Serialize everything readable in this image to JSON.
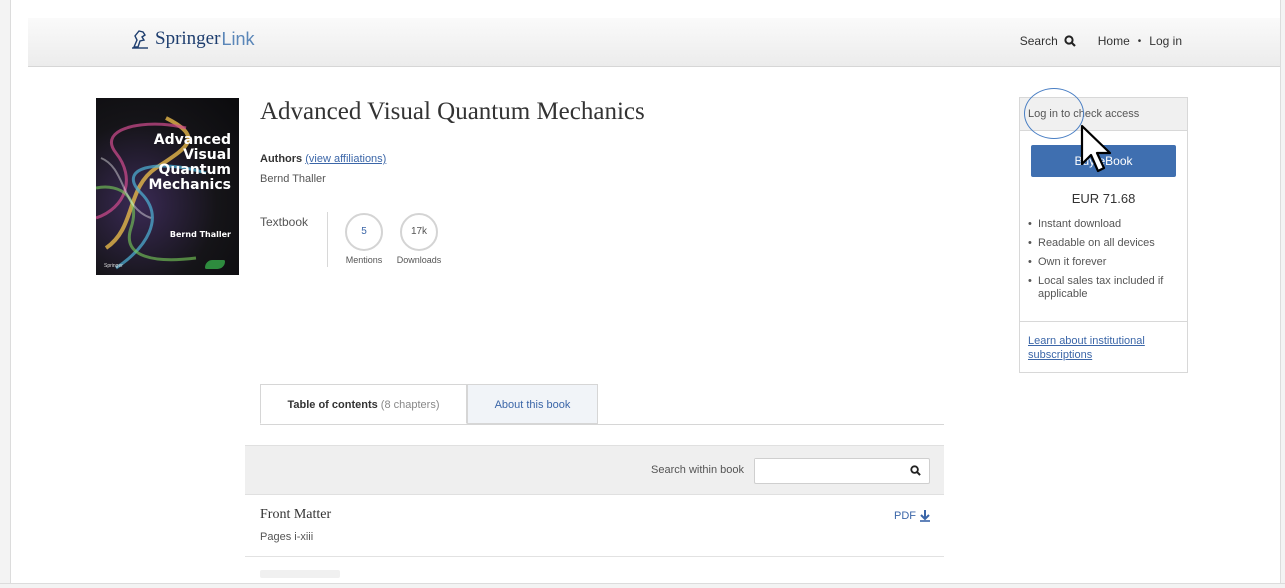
{
  "header": {
    "logo_brand": "Springer",
    "logo_sub": "Link",
    "search_label": "Search",
    "home_label": "Home",
    "login_label": "Log in"
  },
  "cover": {
    "title_line1": "Advanced",
    "title_line2": "Visual",
    "title_line3": "Quantum",
    "title_line4": "Mechanics",
    "author": "Bernd Thaller",
    "publisher": "Springer"
  },
  "book": {
    "title": "Advanced Visual Quantum Mechanics",
    "authors_label": "Authors",
    "affiliations_link": "(view affiliations)",
    "author_name": "Bernd Thaller",
    "type": "Textbook",
    "metrics": [
      {
        "value": "5",
        "label": "Mentions"
      },
      {
        "value": "17k",
        "label": "Downloads"
      }
    ]
  },
  "tabs": {
    "toc_label": "Table of contents",
    "toc_count": "(8 chapters)",
    "about_label": "About this book"
  },
  "search_within": {
    "label": "Search within book",
    "placeholder": ""
  },
  "chapters": [
    {
      "title": "Front Matter",
      "pages": "Pages i-xiii",
      "pdf": "PDF"
    }
  ],
  "buybox": {
    "header": "Log in to check access",
    "buy_button": "Buy eBook",
    "price": "EUR 71.68",
    "perks": [
      "Instant download",
      "Readable on all devices",
      "Own it forever",
      "Local sales tax included if applicable"
    ],
    "institutional_link": "Learn about institutional subscriptions"
  },
  "colors": {
    "link": "#3b66a8",
    "button": "#3f6fb0",
    "brand": "#1d3d6e"
  }
}
